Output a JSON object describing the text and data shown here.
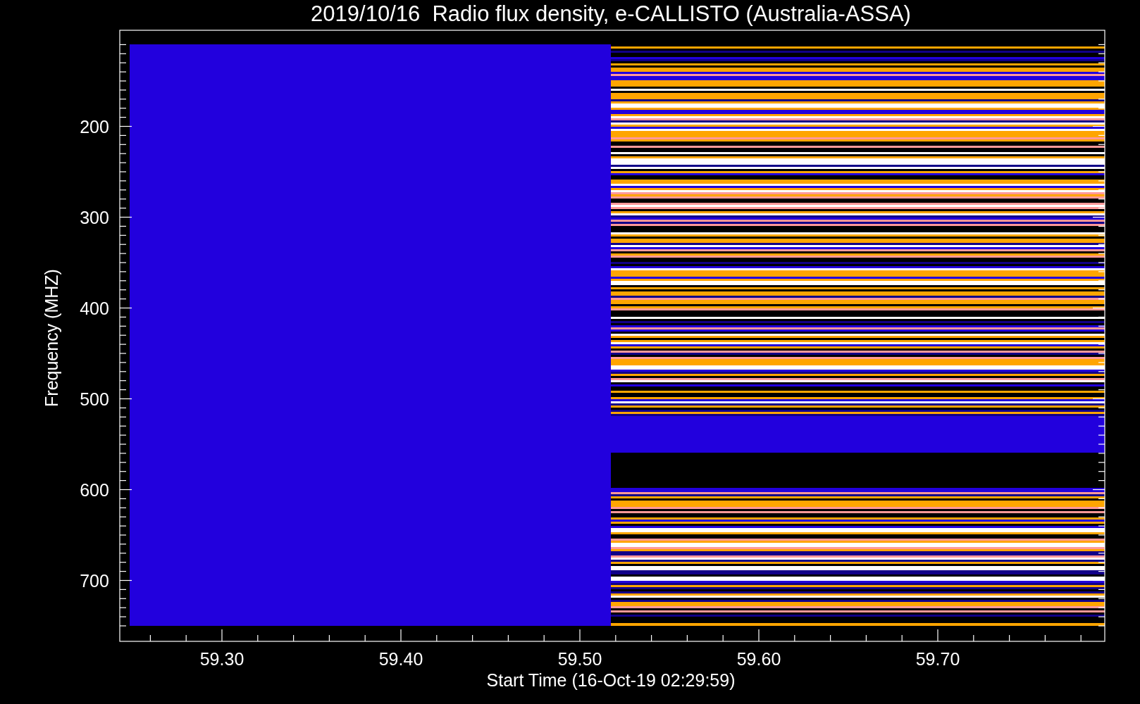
{
  "title": "2019/10/16  Radio flux density, e-CALLISTO (Australia-ASSA)",
  "y_axis": {
    "label": "Frequency (MHZ)",
    "ticks": [
      "200",
      "300",
      "400",
      "500",
      "600",
      "700"
    ]
  },
  "x_axis": {
    "label": "Start Time (16-Oct-19 02:29:59)",
    "ticks": [
      "59.30",
      "59.40",
      "59.50",
      "59.60",
      "59.70"
    ]
  }
}
